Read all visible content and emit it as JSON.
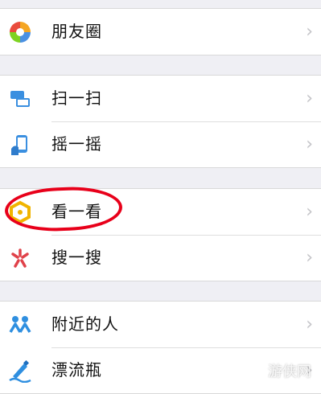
{
  "menu": {
    "group1": [
      {
        "label": "朋友圈",
        "icon": "moments-icon"
      }
    ],
    "group2": [
      {
        "label": "扫一扫",
        "icon": "scan-icon"
      },
      {
        "label": "摇一摇",
        "icon": "shake-icon"
      }
    ],
    "group3": [
      {
        "label": "看一看",
        "icon": "top-stories-icon"
      },
      {
        "label": "搜一搜",
        "icon": "search-icon"
      }
    ],
    "group4": [
      {
        "label": "附近的人",
        "icon": "people-nearby-icon"
      },
      {
        "label": "漂流瓶",
        "icon": "drift-bottle-icon"
      }
    ]
  },
  "chevron": "›",
  "watermark": "游侠网",
  "colors": {
    "background": "#efeff4",
    "annotation": "#e8001a"
  }
}
